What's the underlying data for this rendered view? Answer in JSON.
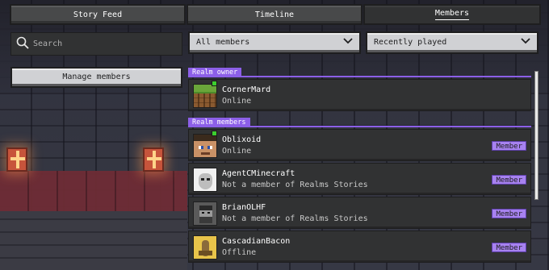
{
  "tabs": [
    {
      "label": "Story Feed",
      "active": false
    },
    {
      "label": "Timeline",
      "active": false
    },
    {
      "label": "Members",
      "active": true
    }
  ],
  "search": {
    "placeholder": "Search",
    "icon": "search-icon"
  },
  "filters": {
    "members_filter": {
      "selected": "All members",
      "icon": "chevron-down-icon"
    },
    "sort": {
      "selected": "Recently played",
      "icon": "chevron-down-icon"
    }
  },
  "manage_button": {
    "label": "Manage members"
  },
  "sections": {
    "owner": {
      "title": "Realm owner",
      "members": [
        {
          "name": "CornerMard",
          "status": "Online",
          "online": true,
          "avatar": "grass-block-avatar",
          "badge": ""
        }
      ]
    },
    "members": {
      "title": "Realm members",
      "members": [
        {
          "name": "Oblixoid",
          "status": "Online",
          "online": true,
          "avatar": "steve-avatar",
          "badge": "Member"
        },
        {
          "name": "AgentCMinecraft",
          "status": "Not a member of Realms Stories",
          "online": false,
          "avatar": "portrait-avatar",
          "badge": "Member"
        },
        {
          "name": "BrianOLHF",
          "status": "Not a member of Realms Stories",
          "online": false,
          "avatar": "bearded-avatar",
          "badge": "Member"
        },
        {
          "name": "CascadianBacon",
          "status": "Offline",
          "online": false,
          "avatar": "yellow-figure-avatar",
          "badge": "Member"
        }
      ]
    }
  },
  "colors": {
    "accent": "#8c5fe8",
    "badge": "#a782f0",
    "online": "#3ccf2e",
    "panel": "#313233"
  }
}
